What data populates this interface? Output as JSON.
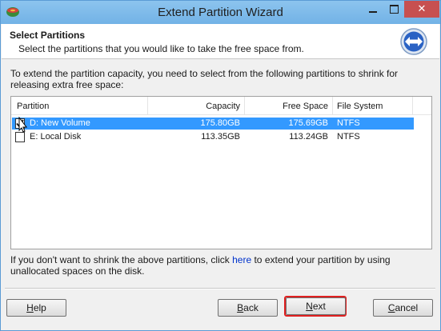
{
  "window": {
    "title": "Extend Partition Wizard",
    "close_label": "✕"
  },
  "header": {
    "title": "Select Partitions",
    "subtitle": "Select the partitions that you would like to take the free space from."
  },
  "instructions": "To extend the partition capacity, you need to select from the following partitions to shrink for releasing extra free space:",
  "table": {
    "columns": [
      "Partition",
      "Capacity",
      "Free Space",
      "File System"
    ],
    "rows": [
      {
        "partition": "D: New Volume",
        "capacity": "175.80GB",
        "free_space": "175.69GB",
        "file_system": "NTFS",
        "checked": true,
        "selected": true
      },
      {
        "partition": "E: Local Disk",
        "capacity": "113.35GB",
        "free_space": "113.24GB",
        "file_system": "NTFS",
        "checked": false,
        "selected": false
      }
    ]
  },
  "footnote": {
    "before": "If you don't want to shrink the above partitions, click ",
    "link": "here",
    "after": " to extend your partition by using unallocated spaces on the disk."
  },
  "buttons": {
    "help": {
      "accel": "H",
      "rest": "elp"
    },
    "back": {
      "accel": "B",
      "rest": "ack"
    },
    "next": {
      "accel": "N",
      "rest": "ext"
    },
    "cancel": {
      "accel": "C",
      "rest": "ancel"
    }
  },
  "colors": {
    "selection": "#3399ff",
    "title_bar": "#8cc4ee",
    "highlight": "#e02020",
    "link": "#0033cc"
  }
}
